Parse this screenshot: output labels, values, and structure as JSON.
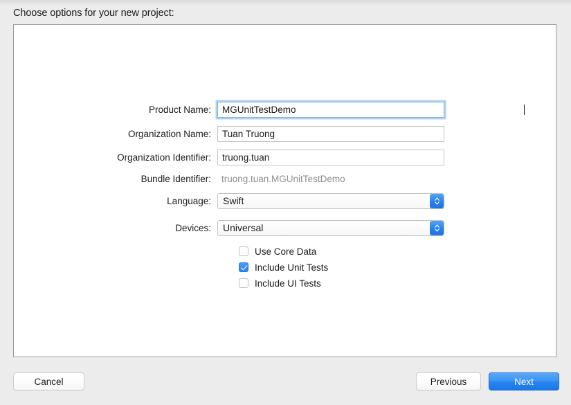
{
  "header": {
    "title": "Choose options for your new project:"
  },
  "form": {
    "fields": [
      {
        "label": "Product Name:",
        "value": "MGUnitTestDemo",
        "type": "text",
        "focused": true
      },
      {
        "label": "Organization Name:",
        "value": "Tuan Truong",
        "type": "text",
        "focused": false
      },
      {
        "label": "Organization Identifier:",
        "value": "truong.tuan",
        "type": "text",
        "focused": false
      },
      {
        "label": "Bundle Identifier:",
        "value": "truong.tuan.MGUnitTestDemo",
        "type": "readonly",
        "focused": false
      },
      {
        "label": "Language:",
        "value": "Swift",
        "type": "select",
        "focused": false
      },
      {
        "label": "Devices:",
        "value": "Universal",
        "type": "select",
        "focused": false
      }
    ],
    "checkboxes": [
      {
        "label": "Use Core Data",
        "checked": false
      },
      {
        "label": "Include Unit Tests",
        "checked": true
      },
      {
        "label": "Include UI Tests",
        "checked": false
      }
    ]
  },
  "footer": {
    "cancel_label": "Cancel",
    "previous_label": "Previous",
    "next_label": "Next"
  },
  "colors": {
    "accent_blue": "#2785ef",
    "focus_ring": "#83b5e9",
    "page_background": "#ececec",
    "panel_background": "#ffffff",
    "readonly_text": "#8e8e8e"
  }
}
